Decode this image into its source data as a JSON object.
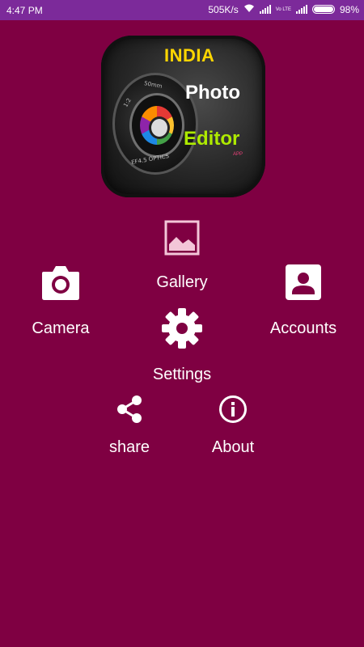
{
  "status_bar": {
    "time": "4:47 PM",
    "speed": "505K/s",
    "lte": "Vo LTE",
    "battery": "98%",
    "battery_level": 0.98
  },
  "logo": {
    "line1": "INDIA",
    "line2": "Photo",
    "line3": "Editor",
    "small": "APP",
    "lens_text_1": "1:2",
    "lens_text_2": "50mm",
    "lens_text_3": "EF4.5 OPTICS",
    "colors": {
      "india": "#ffd600",
      "photo": "#ffffff",
      "editor": "#aeea00"
    }
  },
  "menu": {
    "gallery": "Gallery",
    "camera": "Camera",
    "accounts": "Accounts",
    "settings": "Settings",
    "share": "share",
    "about": "About"
  },
  "theme": {
    "background": "#7f0042",
    "status_bar": "#7c2a9a"
  }
}
